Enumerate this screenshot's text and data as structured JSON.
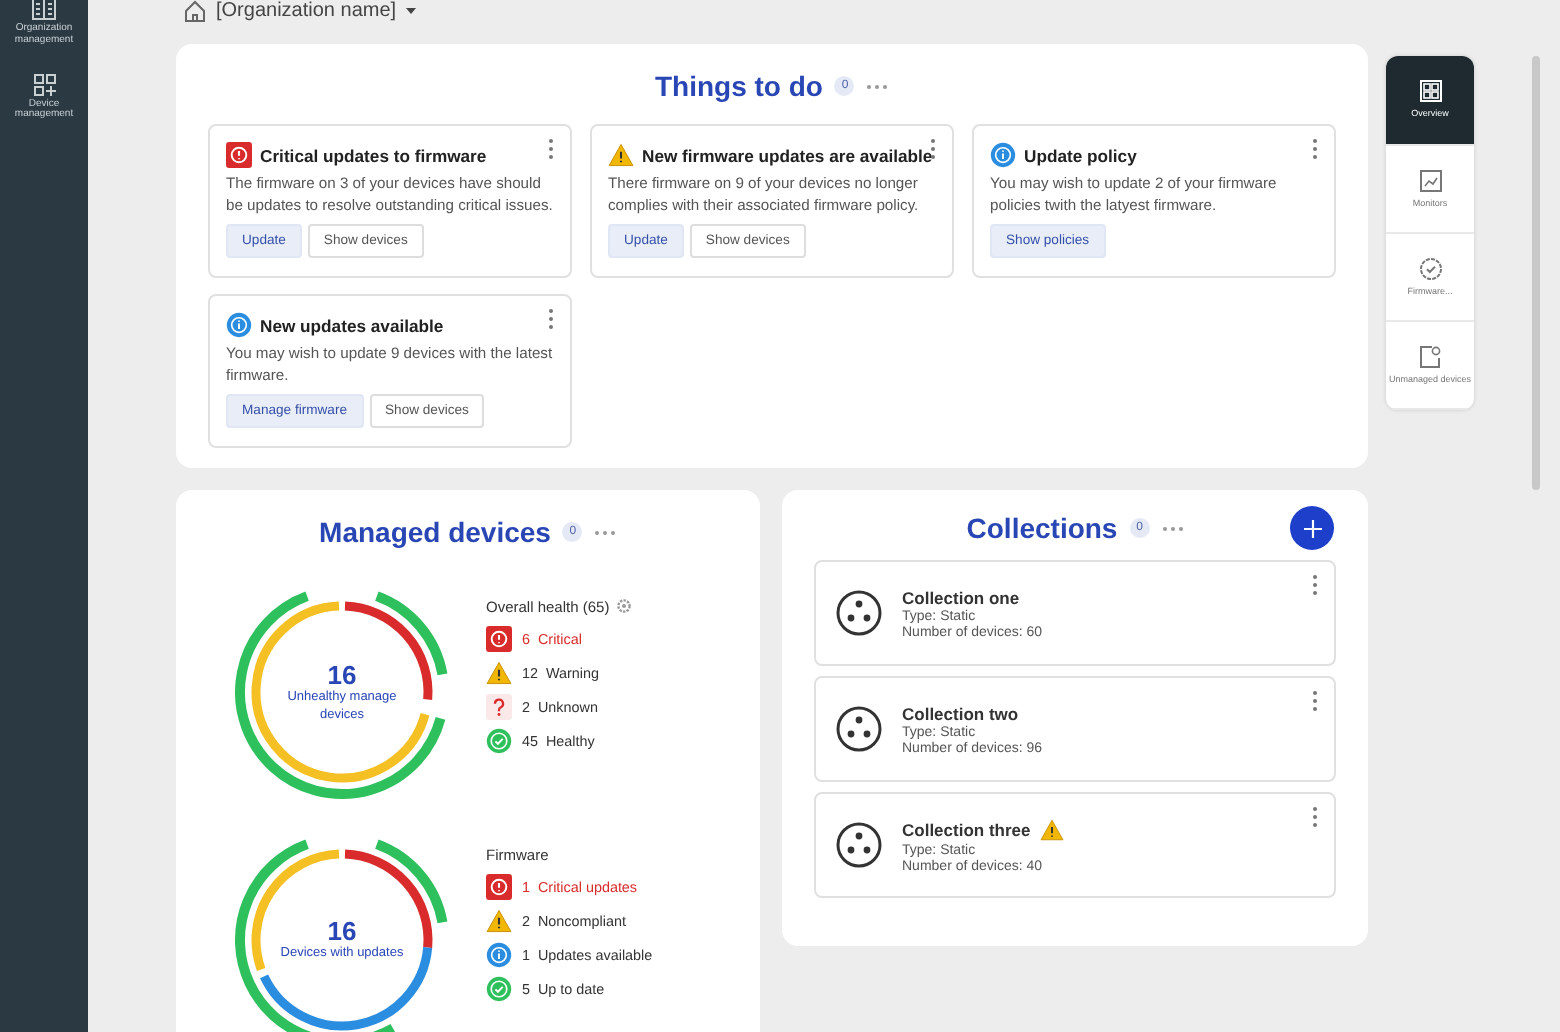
{
  "sidebar": {
    "items": [
      {
        "label": "Organization management"
      },
      {
        "label": "Device management"
      }
    ]
  },
  "breadcrumb": {
    "label": "[Organization name]"
  },
  "things_to_do": {
    "title": "Things to do",
    "count": "0",
    "cards": [
      {
        "kind": "critical",
        "title": "Critical updates to firmware",
        "text": "The firmware on 3 of your devices have should be updates to resolve outstanding critical  issues.",
        "buttons": [
          {
            "label": "Update",
            "primary": true
          },
          {
            "label": "Show devices",
            "primary": false
          }
        ]
      },
      {
        "kind": "warning",
        "title": "New firmware updates are available",
        "text": "There firmware on 9 of your devices no longer complies with their associated firmware policy.",
        "buttons": [
          {
            "label": "Update",
            "primary": true
          },
          {
            "label": "Show devices",
            "primary": false
          }
        ]
      },
      {
        "kind": "info",
        "title": "Update policy",
        "text": "You may wish to update 2 of your firmware policies twith the latyest firmware.",
        "buttons": [
          {
            "label": "Show policies",
            "primary": true
          }
        ]
      },
      {
        "kind": "info",
        "title": "New updates available",
        "text": "You may wish to update  9 devices with the latest firmware.",
        "buttons": [
          {
            "label": "Manage firmware",
            "primary": true
          },
          {
            "label": "Show devices",
            "primary": false
          }
        ]
      }
    ]
  },
  "managed_devices": {
    "title": "Managed devices",
    "count": "0",
    "groups": [
      {
        "number": "16",
        "caption": "Unhealthy manage devices",
        "heading": "Overall health (65)",
        "settings": true,
        "legend": [
          {
            "kind": "critical",
            "count": "6",
            "label": "Critical"
          },
          {
            "kind": "warning",
            "count": "12",
            "label": "Warning"
          },
          {
            "kind": "unknown",
            "count": "2",
            "label": "Unknown"
          },
          {
            "kind": "healthy",
            "count": "45",
            "label": "Healthy"
          }
        ]
      },
      {
        "number": "16",
        "caption": "Devices with updates",
        "heading": "Firmware",
        "settings": false,
        "legend": [
          {
            "kind": "critical",
            "count": "1",
            "label": "Critical updates"
          },
          {
            "kind": "warning",
            "count": "2",
            "label": "Noncompliant"
          },
          {
            "kind": "info",
            "count": "1",
            "label": "Updates available"
          },
          {
            "kind": "healthy",
            "count": "5",
            "label": "Up to date"
          }
        ]
      }
    ]
  },
  "collections": {
    "title": "Collections",
    "count": "0",
    "items": [
      {
        "name": "Collection one",
        "type": "Type: Static",
        "devices": "Number of devices: 60",
        "warning": false
      },
      {
        "name": "Collection two",
        "type": "Type: Static",
        "devices": "Number of devices: 96",
        "warning": false
      },
      {
        "name": "Collection three",
        "type": "Type: Static",
        "devices": "Number of devices: 40",
        "warning": true
      }
    ]
  },
  "rail": {
    "items": [
      {
        "label": "Overview",
        "selected": true
      },
      {
        "label": "Monitors",
        "selected": false
      },
      {
        "label": "Firmware...",
        "selected": false
      },
      {
        "label": "Unmanaged devices",
        "selected": false
      }
    ]
  }
}
